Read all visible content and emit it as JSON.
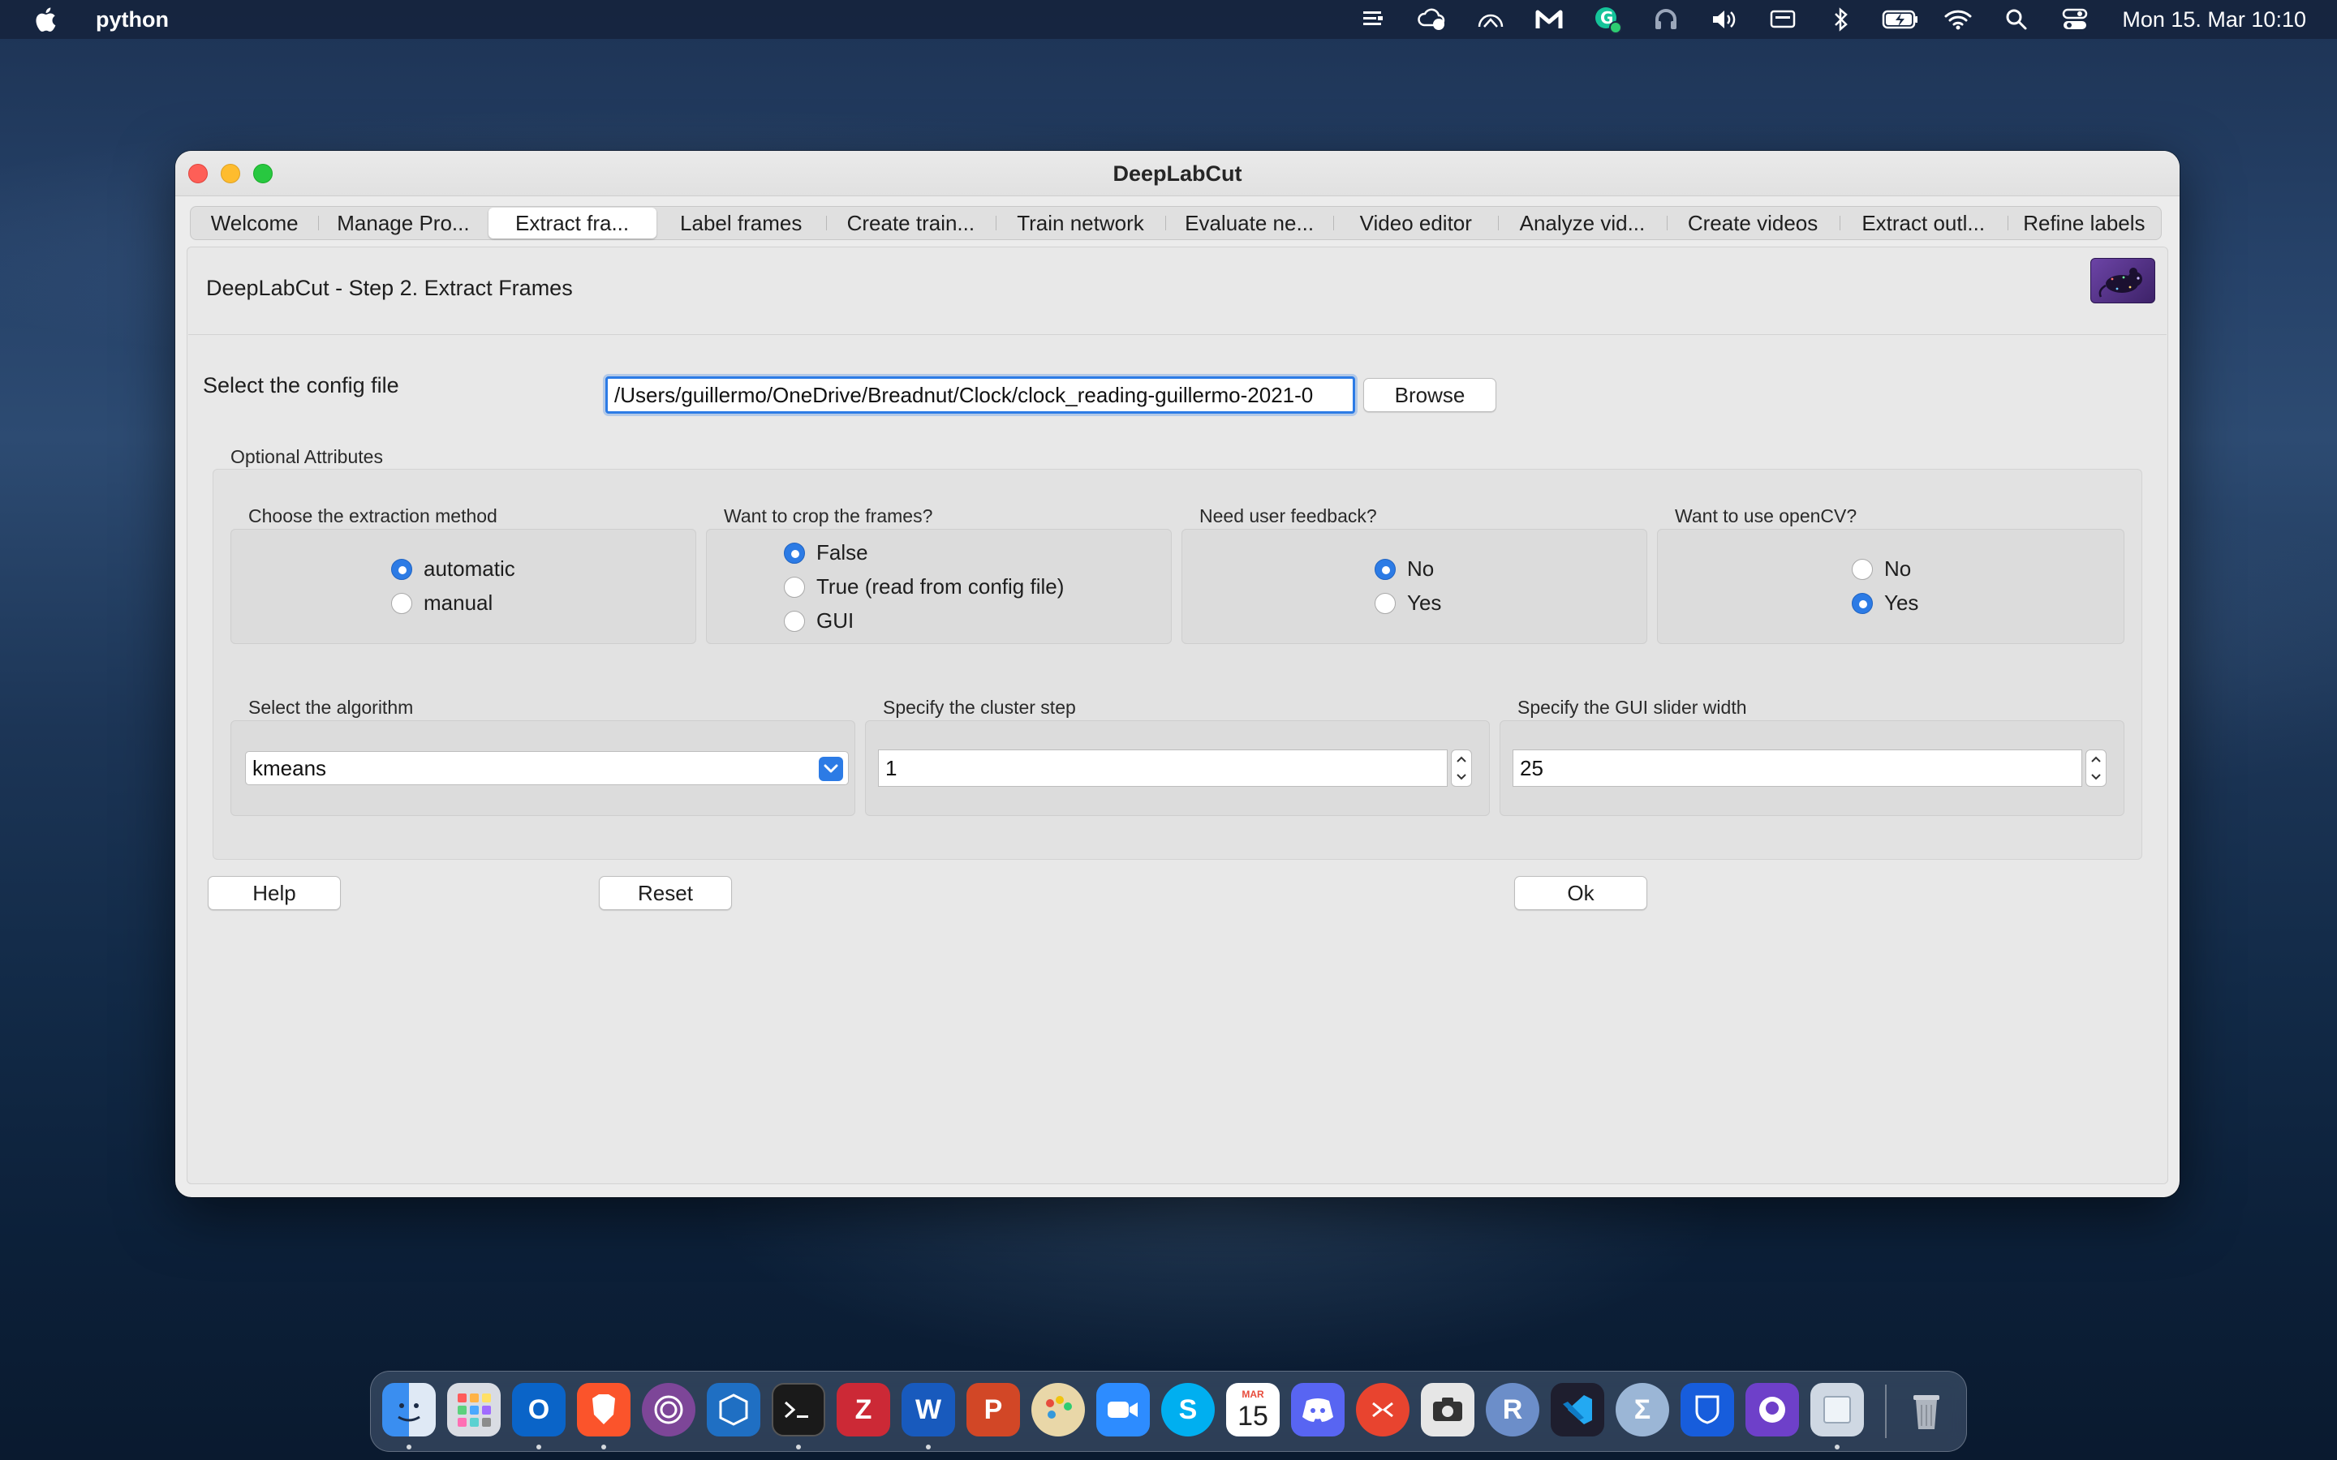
{
  "menubar": {
    "app_name": "python",
    "clock": "Mon 15. Mar  10:10",
    "status_icons": [
      "list-icon",
      "cloud-sync-icon",
      "gauge-icon",
      "malwarebytes-icon",
      "grammarly-icon",
      "headphones-icon",
      "volume-icon",
      "display-icon",
      "bluetooth-icon",
      "battery-icon",
      "wifi-icon",
      "spotlight-search-icon",
      "control-center-icon"
    ]
  },
  "window": {
    "title": "DeepLabCut",
    "tabs": [
      {
        "label": "Welcome"
      },
      {
        "label": "Manage Pro..."
      },
      {
        "label": "Extract fra..."
      },
      {
        "label": "Label frames"
      },
      {
        "label": "Create train..."
      },
      {
        "label": "Train network"
      },
      {
        "label": "Evaluate ne..."
      },
      {
        "label": "Video editor"
      },
      {
        "label": "Analyze vid..."
      },
      {
        "label": "Create videos"
      },
      {
        "label": "Extract outl..."
      },
      {
        "label": "Refine labels"
      }
    ],
    "active_tab": "Extract fra..."
  },
  "page": {
    "header": "DeepLabCut - Step 2. Extract Frames",
    "config": {
      "label": "Select the config file",
      "value": "/Users/guillermo/OneDrive/Breadnut/Clock/clock_reading-guillermo-2021-0",
      "browse_label": "Browse"
    },
    "optional_title": "Optional Attributes",
    "extraction_method": {
      "label": "Choose the extraction method",
      "options": [
        "automatic",
        "manual"
      ],
      "selected": "automatic"
    },
    "crop": {
      "label": "Want to crop the frames?",
      "options": [
        "False",
        "True (read from config file)",
        "GUI"
      ],
      "selected": "False"
    },
    "feedback": {
      "label": "Need user feedback?",
      "options": [
        "No",
        "Yes"
      ],
      "selected": "No"
    },
    "opencv": {
      "label": "Want to use openCV?",
      "options": [
        "No",
        "Yes"
      ],
      "selected": "Yes"
    },
    "algorithm": {
      "label": "Select the algorithm",
      "value": "kmeans"
    },
    "cluster_step": {
      "label": "Specify the cluster step",
      "value": "1"
    },
    "slider_width": {
      "label": "Specify the GUI slider width",
      "value": "25"
    },
    "buttons": {
      "help": "Help",
      "reset": "Reset",
      "ok": "Ok"
    }
  },
  "dock": {
    "apps": [
      "finder-icon",
      "launchpad-icon",
      "outlook-icon",
      "brave-icon",
      "tor-icon",
      "virtualbox-icon",
      "terminal-icon",
      "zotero-icon",
      "word-icon",
      "powerpoint-icon",
      "paintbrush-icon",
      "zoom-icon",
      "skype-icon",
      "calendar-icon",
      "discord-icon",
      "remote-desktop-icon",
      "screenshot-icon",
      "r-icon",
      "vscode-icon",
      "sigma-icon",
      "bitwarden-icon",
      "github-icon",
      "preview-icon",
      "trash-icon"
    ],
    "calendar_month": "MAR",
    "calendar_day": "15"
  }
}
